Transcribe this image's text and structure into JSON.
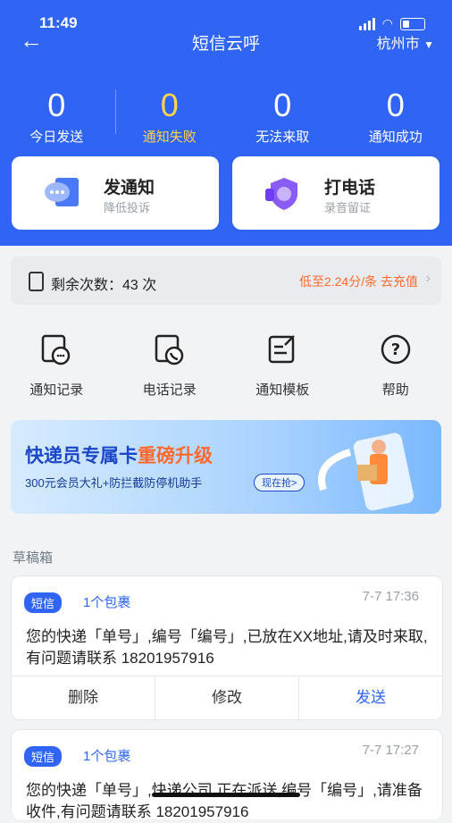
{
  "status": {
    "time": "11:49"
  },
  "nav": {
    "title": "短信云呼",
    "city": "杭州市"
  },
  "stats": [
    {
      "num": "0",
      "label": "今日发送"
    },
    {
      "num": "0",
      "label": "通知失败"
    },
    {
      "num": "0",
      "label": "无法来取"
    },
    {
      "num": "0",
      "label": "通知成功"
    }
  ],
  "cards": [
    {
      "title": "发通知",
      "sub": "降低投诉"
    },
    {
      "title": "打电话",
      "sub": "录音留证"
    }
  ],
  "remain": {
    "label": "剩余次数：43 次",
    "promo": "低至2.24分/条  去充值"
  },
  "grid": [
    {
      "label": "通知记录",
      "icon": "notice-record-icon"
    },
    {
      "label": "电话记录",
      "icon": "call-record-icon"
    },
    {
      "label": "通知模板",
      "icon": "template-icon"
    },
    {
      "label": "帮助",
      "icon": "help-icon"
    }
  ],
  "banner": {
    "title_a": "快递员专属卡",
    "title_b": "重磅升级",
    "sub": "300元会员大礼+防拦截防停机助手",
    "btn": "现在抢>"
  },
  "drafts_title": "草稿箱",
  "drafts": [
    {
      "tag": "短信",
      "pkg": "1个包裹",
      "time": "7-7 17:36",
      "text": "您的快递「单号」,编号「编号」,已放在XX地址,请及时来取,有问题请联系 18201957916",
      "actions": [
        "删除",
        "修改",
        "发送"
      ]
    },
    {
      "tag": "短信",
      "pkg": "1个包裹",
      "time": "7-7 17:27",
      "text": "您的快递「单号」,快递公司,正在派送,编号「编号」,请准备收件,有问题请联系 18201957916"
    }
  ],
  "colors": {
    "primary": "#2f64f5",
    "fail": "#ffd34e",
    "promo": "#ff6a2e"
  }
}
